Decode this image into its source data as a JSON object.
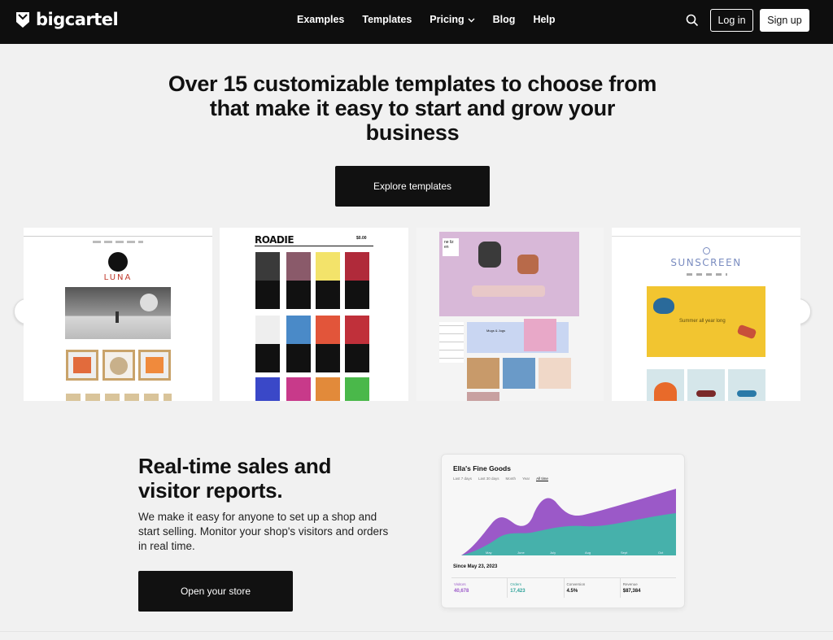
{
  "nav": {
    "logo_text": "bigcartel",
    "links": [
      "Examples",
      "Templates",
      "Pricing",
      "Blog",
      "Help"
    ],
    "login_label": "Log in",
    "signup_label": "Sign up"
  },
  "hero": {
    "title": "Over 15 customizable templates to choose from that make it easy to start and grow your business",
    "cta_label": "Explore templates"
  },
  "templates": {
    "luna": {
      "name": "LUNA"
    },
    "roadie": {
      "name": "ROADIE",
      "cart": "$0.00"
    },
    "nelizen": {
      "name": "ne liz en",
      "sub": "Mugs & Jugs"
    },
    "sunscreen": {
      "name": "SUNSCREEN",
      "tagline": "Summer all year long"
    }
  },
  "reports": {
    "title": "Real-time sales and visitor reports.",
    "body": "We make it easy for anyone to set up a shop and start selling. Monitor your shop's visitors and orders in real time.",
    "cta_label": "Open your store"
  },
  "dashboard": {
    "store_name": "Ella's Fine Goods",
    "tabs": [
      "Last 7 days",
      "Last 30 days",
      "Month",
      "Year",
      "All time"
    ],
    "active_tab": "All time",
    "since": "Since May 23, 2023",
    "chart_months": [
      "May",
      "June",
      "July",
      "Aug",
      "Sept",
      "Oct"
    ],
    "colors": {
      "visitors": "#9b59c8",
      "orders": "#3fb8a8"
    },
    "stats": [
      {
        "label": "Visitors",
        "value": "40,678",
        "color": "#9b59c8"
      },
      {
        "label": "Orders",
        "value": "17,423",
        "color": "#2aa198"
      },
      {
        "label": "Conversion",
        "value": "4.5%",
        "color": "#111111"
      },
      {
        "label": "Revenue",
        "value": "$87,384",
        "color": "#111111"
      }
    ]
  }
}
